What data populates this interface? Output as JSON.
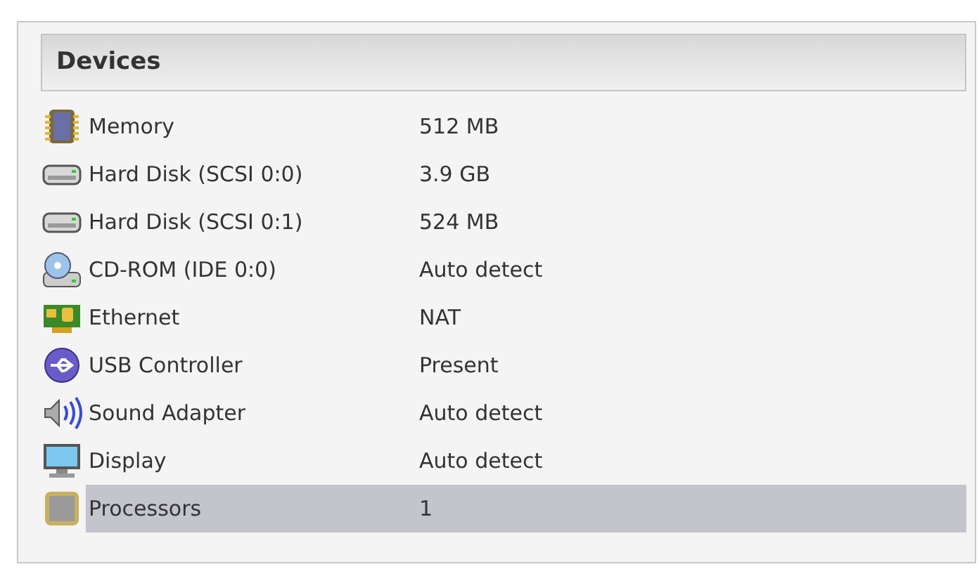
{
  "panel": {
    "title": "Devices"
  },
  "devices": [
    {
      "kind": "memory",
      "name": "Memory",
      "value": "512 MB",
      "selected": false
    },
    {
      "kind": "disk",
      "name": "Hard Disk (SCSI 0:0)",
      "value": "3.9 GB",
      "selected": false
    },
    {
      "kind": "disk",
      "name": "Hard Disk (SCSI 0:1)",
      "value": "524 MB",
      "selected": false
    },
    {
      "kind": "cdrom",
      "name": "CD-ROM (IDE 0:0)",
      "value": "Auto detect",
      "selected": false
    },
    {
      "kind": "ethernet",
      "name": "Ethernet",
      "value": "NAT",
      "selected": false
    },
    {
      "kind": "usb",
      "name": "USB Controller",
      "value": "Present",
      "selected": false
    },
    {
      "kind": "sound",
      "name": "Sound Adapter",
      "value": "Auto detect",
      "selected": false
    },
    {
      "kind": "display",
      "name": "Display",
      "value": "Auto detect",
      "selected": false
    },
    {
      "kind": "processor",
      "name": "Processors",
      "value": "1",
      "selected": true
    }
  ]
}
